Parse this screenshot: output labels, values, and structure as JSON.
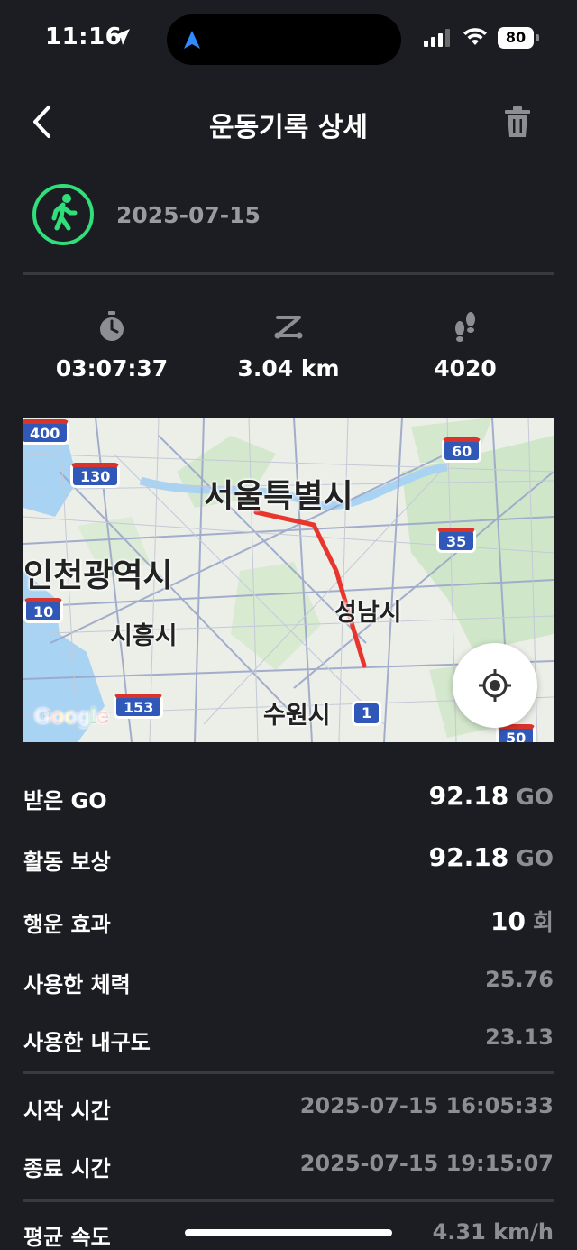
{
  "status_bar": {
    "time": "11:16",
    "battery": "80"
  },
  "header": {
    "title": "운동기록 상세"
  },
  "activity": {
    "date": "2025-07-15"
  },
  "stats": {
    "duration": "03:07:37",
    "distance": "3.04 km",
    "steps": "4020"
  },
  "map": {
    "labels": {
      "seoul": "서울특별시",
      "incheon": "인천광역시",
      "siheung": "시흥시",
      "seongnam": "성남시",
      "suwon": "수원시",
      "google": "Google"
    },
    "shields": {
      "s400": "400",
      "s130": "130",
      "s60": "60",
      "s35": "35",
      "s10": "10",
      "s153": "153",
      "s1": "1",
      "s50": "50"
    },
    "route_color": "#e8362f"
  },
  "details": {
    "received_go": {
      "label": "받은 GO",
      "value": "92.18",
      "unit": "GO"
    },
    "activity_reward": {
      "label": "활동 보상",
      "value": "92.18",
      "unit": "GO"
    },
    "luck_effect": {
      "label": "행운 효과",
      "value": "10",
      "unit": "회"
    },
    "stamina_used": {
      "label": "사용한 체력",
      "value": "25.76"
    },
    "durability_used": {
      "label": "사용한 내구도",
      "value": "23.13"
    },
    "start_time": {
      "label": "시작 시간",
      "value": "2025-07-15 16:05:33"
    },
    "end_time": {
      "label": "종료 시간",
      "value": "2025-07-15 19:15:07"
    },
    "avg_speed": {
      "label": "평균 속도",
      "value": "4.31 km/h"
    }
  },
  "colors": {
    "background": "#1c1d22",
    "accent_green": "#2fe07a",
    "muted_text": "#8d8e94"
  }
}
